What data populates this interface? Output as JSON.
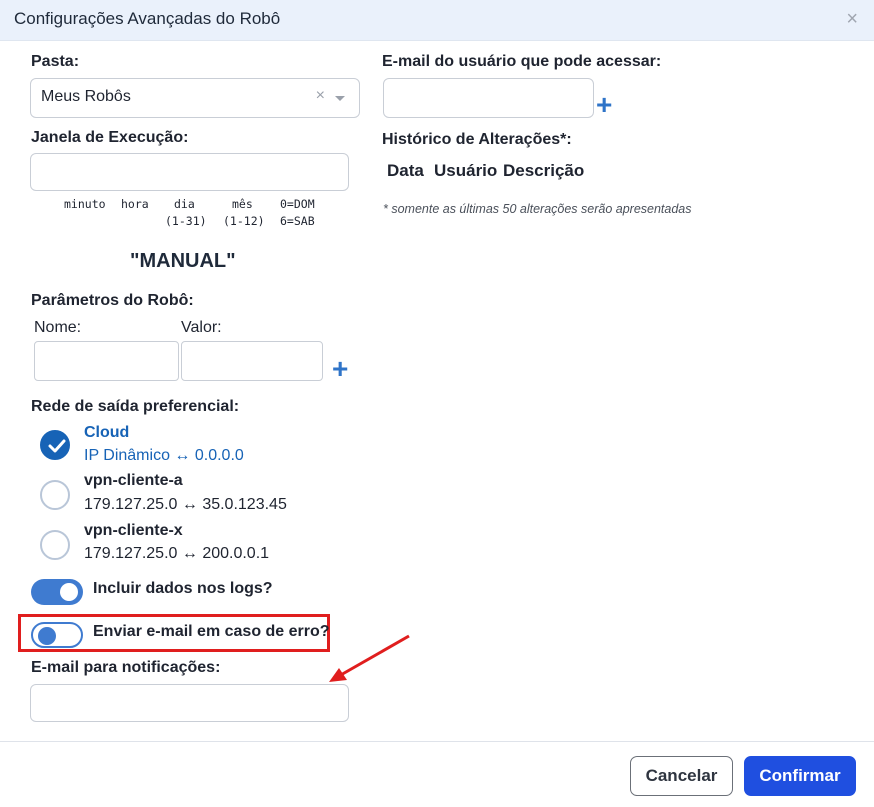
{
  "dialog": {
    "title": "Configurações Avançadas do Robô",
    "close_icon": "×"
  },
  "folder": {
    "label": "Pasta:",
    "value": "Meus Robôs",
    "clear": "×"
  },
  "schedule": {
    "label": "Janela de Execução:",
    "value": "",
    "fields": [
      {
        "name": "minuto",
        "range": ""
      },
      {
        "name": "hora",
        "range": ""
      },
      {
        "name": "dia",
        "range": "(1-31)"
      },
      {
        "name": "mês",
        "range": "(1-12)"
      },
      {
        "name": "0=DOM",
        "range": "6=SAB"
      }
    ],
    "mode_text": "\"MANUAL\""
  },
  "params": {
    "label": "Parâmetros do Robô:",
    "name_label": "Nome:",
    "value_label": "Valor:",
    "add": "+"
  },
  "network": {
    "label": "Rede de saída preferencial:",
    "options": [
      {
        "name": "Cloud",
        "ip": "IP Dinâmico ↔ 0.0.0.0",
        "selected": true
      },
      {
        "name": "vpn-cliente-a",
        "ip": "179.127.25.0 ↔ 35.0.123.45",
        "selected": false
      },
      {
        "name": "vpn-cliente-x",
        "ip": "179.127.25.0 ↔ 200.0.0.1",
        "selected": false
      }
    ]
  },
  "toggles": {
    "logs": {
      "label": "Incluir dados nos logs?",
      "on": true
    },
    "email_error": {
      "label": "Enviar e-mail em caso de erro?",
      "on": false
    }
  },
  "notify": {
    "label": "E-mail para notificações:",
    "value": ""
  },
  "access": {
    "label": "E-mail do usuário que pode acessar:",
    "value": "",
    "add": "+"
  },
  "history": {
    "label": "Histórico de Alterações*:",
    "columns": [
      "Data",
      "Usuário",
      "Descrição"
    ],
    "note": "* somente as últimas 50 alterações serão apresentadas"
  },
  "footer": {
    "cancel": "Cancelar",
    "confirm": "Confirmar"
  },
  "colors": {
    "accent": "#1f4fe0",
    "highlight": "#e01e1e",
    "toggle": "#3f7bd0",
    "link": "#1763b6"
  }
}
